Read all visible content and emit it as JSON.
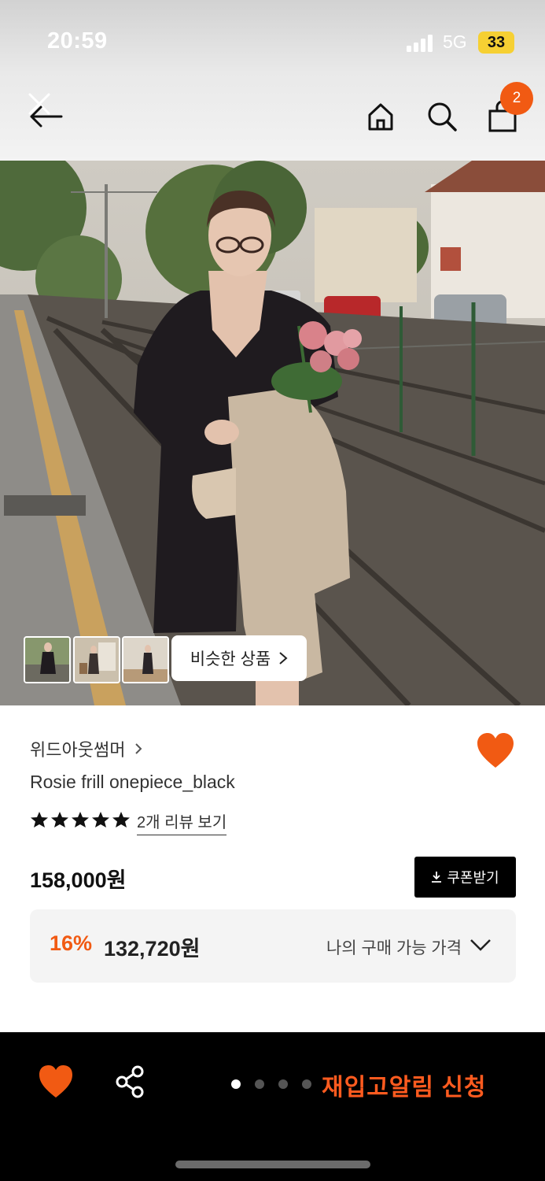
{
  "status_bar": {
    "time": "20:59",
    "network": "5G",
    "battery": "33"
  },
  "header": {
    "icons": [
      "back-arrow-icon",
      "close-icon",
      "home-icon",
      "search-icon",
      "shopping-bag-icon"
    ],
    "cart_count": "2"
  },
  "gallery": {
    "thumbnails": [
      "thumbnail-1",
      "thumbnail-2",
      "thumbnail-3"
    ],
    "similar_button": "비슷한 상품",
    "page_count": 4,
    "active_page": 0
  },
  "product": {
    "brand": "위드아웃썸머",
    "name": "Rosie frill onepiece_black",
    "rating_stars": 5,
    "review_link": "2개 리뷰 보기",
    "price": "158,000원",
    "coupon_button": "쿠폰받기",
    "discount": "16%",
    "sale_price": "132,720원",
    "my_price_label": "나의 구매 가능 가격",
    "wishlisted": true
  },
  "bottom_bar": {
    "restock_button": "재입고알림 신청"
  },
  "colors": {
    "accent": "#f15a13",
    "bottom_bar": "#000000",
    "price_box": "#f4f4f4"
  }
}
